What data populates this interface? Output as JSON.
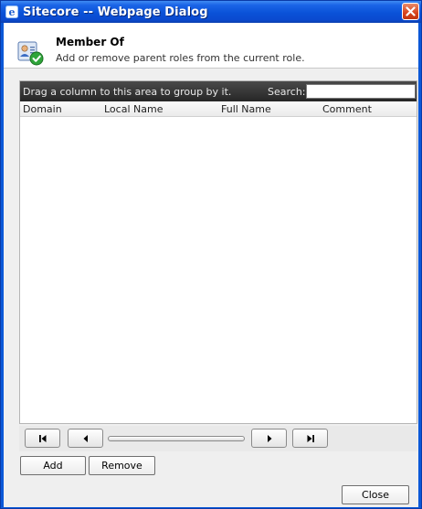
{
  "window": {
    "title": "Sitecore -- Webpage Dialog",
    "title_icon": "ie-icon",
    "close_icon": "close-icon"
  },
  "header": {
    "title": "Member Of",
    "description": "Add or remove parent roles from the current role.",
    "icon": "user-role-check-icon"
  },
  "grid": {
    "group_hint": "Drag a column to this area to group by it.",
    "search_label": "Search:",
    "search_value": "",
    "columns": [
      "Domain",
      "Local Name",
      "Full Name",
      "Comment"
    ],
    "rows": []
  },
  "pager": {
    "first_icon": "first-page-icon",
    "prev_icon": "previous-page-icon",
    "next_icon": "next-page-icon",
    "last_icon": "last-page-icon"
  },
  "actions": {
    "add_label": "Add",
    "remove_label": "Remove",
    "close_label": "Close"
  }
}
